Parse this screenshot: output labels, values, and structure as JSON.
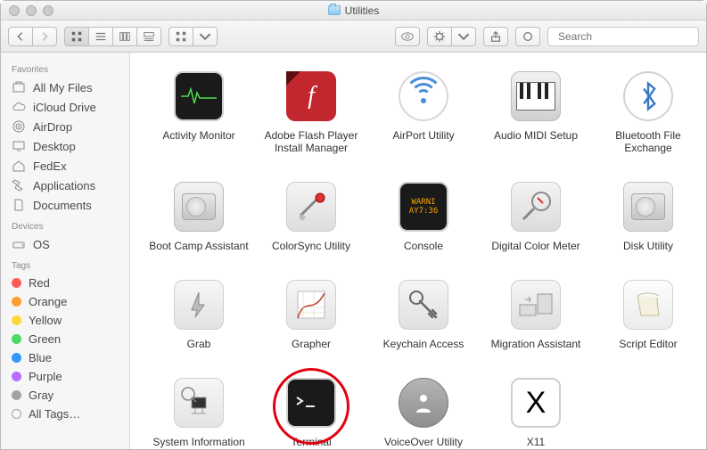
{
  "window": {
    "title": "Utilities"
  },
  "toolbar": {
    "search_placeholder": "Search"
  },
  "sidebar": {
    "sections": [
      {
        "header": "Favorites",
        "items": [
          {
            "label": "All My Files",
            "icon": "all-my-files"
          },
          {
            "label": "iCloud Drive",
            "icon": "cloud"
          },
          {
            "label": "AirDrop",
            "icon": "airdrop"
          },
          {
            "label": "Desktop",
            "icon": "desktop"
          },
          {
            "label": "FedEx",
            "icon": "home"
          },
          {
            "label": "Applications",
            "icon": "applications"
          },
          {
            "label": "Documents",
            "icon": "documents"
          }
        ]
      },
      {
        "header": "Devices",
        "items": [
          {
            "label": "OS",
            "icon": "disk"
          }
        ]
      },
      {
        "header": "Tags",
        "tags": [
          {
            "label": "Red",
            "color": "#ff5b56"
          },
          {
            "label": "Orange",
            "color": "#ff9e2c"
          },
          {
            "label": "Yellow",
            "color": "#ffd63b"
          },
          {
            "label": "Green",
            "color": "#4cd964"
          },
          {
            "label": "Blue",
            "color": "#3498ff"
          },
          {
            "label": "Purple",
            "color": "#b66dff"
          },
          {
            "label": "Gray",
            "color": "#a2a2a2"
          },
          {
            "label": "All Tags…",
            "color": null
          }
        ]
      }
    ]
  },
  "items": [
    {
      "label": "Activity Monitor",
      "icon": "activity"
    },
    {
      "label": "Adobe Flash Player Install Manager",
      "icon": "flash"
    },
    {
      "label": "AirPort Utility",
      "icon": "airport"
    },
    {
      "label": "Audio MIDI Setup",
      "icon": "midi"
    },
    {
      "label": "Bluetooth File Exchange",
      "icon": "bluetooth"
    },
    {
      "label": "Boot Camp Assistant",
      "icon": "bootcamp"
    },
    {
      "label": "ColorSync Utility",
      "icon": "colorsync"
    },
    {
      "label": "Console",
      "icon": "console"
    },
    {
      "label": "Digital Color Meter",
      "icon": "dcm"
    },
    {
      "label": "Disk Utility",
      "icon": "disk-util"
    },
    {
      "label": "Grab",
      "icon": "grab"
    },
    {
      "label": "Grapher",
      "icon": "grapher"
    },
    {
      "label": "Keychain Access",
      "icon": "keychain"
    },
    {
      "label": "Migration Assistant",
      "icon": "migration"
    },
    {
      "label": "Script Editor",
      "icon": "script"
    },
    {
      "label": "System Information",
      "icon": "sysinfo"
    },
    {
      "label": "Terminal",
      "icon": "terminal",
      "highlight": true
    },
    {
      "label": "VoiceOver Utility",
      "icon": "voiceover"
    },
    {
      "label": "X11",
      "icon": "x11"
    }
  ]
}
